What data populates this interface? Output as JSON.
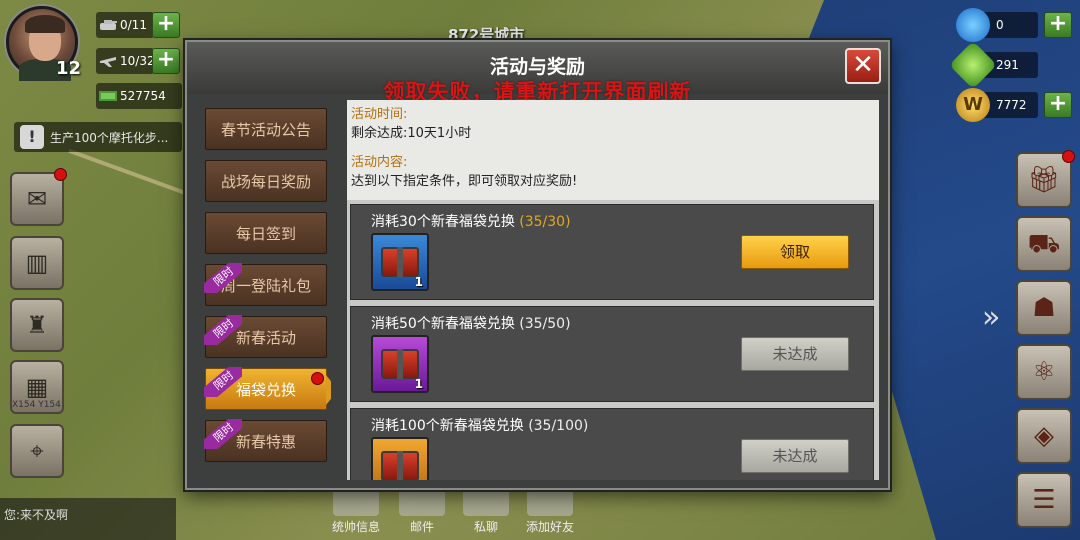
{
  "map": {
    "city_label": "872号城市",
    "coord_label": "X154 Y154"
  },
  "player": {
    "level": "12"
  },
  "resources_left": [
    {
      "icon": "tank-icon",
      "value": "0/11"
    },
    {
      "icon": "plane-icon",
      "value": "10/32"
    },
    {
      "icon": "money-icon",
      "value": "527754"
    }
  ],
  "resources_right": [
    {
      "icon": "diamond-icon",
      "value": "0"
    },
    {
      "icon": "gem-icon",
      "value": "291"
    },
    {
      "icon": "coin-icon",
      "value": "7772"
    }
  ],
  "task_bar": {
    "text": "生产100个摩托化步..."
  },
  "chat": {
    "text": "您:来不及啊"
  },
  "bottom_nav": [
    "统帅信息",
    "邮件",
    "私聊",
    "添加好友"
  ],
  "dialog": {
    "title": "活动与奖励",
    "error": "领取失败，请重新打开界面刷新",
    "close_label": "✕",
    "menu": [
      {
        "label": "春节活动公告",
        "tag": ""
      },
      {
        "label": "战场每日奖励",
        "tag": ""
      },
      {
        "label": "每日签到",
        "tag": ""
      },
      {
        "label": "周一登陆礼包",
        "tag": "限时"
      },
      {
        "label": "新春活动",
        "tag": "限时"
      },
      {
        "label": "福袋兑换",
        "tag": "限时"
      },
      {
        "label": "新春特惠",
        "tag": "限时"
      }
    ],
    "info": {
      "time_label": "活动时间:",
      "time_value": "剩余达成:10天1小时",
      "content_label": "活动内容:",
      "content_value": "达到以下指定条件，即可领取对应奖励!"
    },
    "tasks": [
      {
        "title": "消耗30个新春福袋兑换",
        "progress": "(35/30)",
        "reward_count": "1",
        "button": "领取"
      },
      {
        "title": "消耗50个新春福袋兑换",
        "progress": "(35/50)",
        "reward_count": "1",
        "button": "未达成"
      },
      {
        "title": "消耗100个新春福袋兑换",
        "progress": "(35/100)",
        "reward_count": "",
        "button": "未达成"
      }
    ]
  },
  "colors": {
    "accent": "#e89a10",
    "error": "#d81414",
    "tag": "#9a2aa0"
  }
}
